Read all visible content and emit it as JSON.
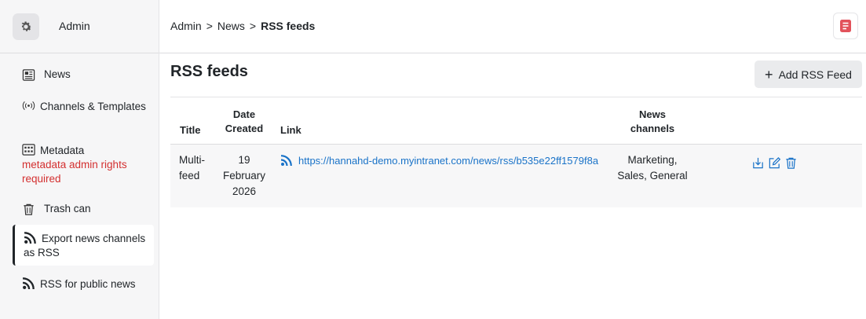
{
  "sidebar": {
    "title": "Admin",
    "items": [
      {
        "label": "News",
        "icon": "newspaper-icon"
      },
      {
        "label": "Channels & Templates",
        "icon": "broadcast-icon"
      },
      {
        "label": "Metadata",
        "warning": "metadata admin rights required",
        "icon": "metadata-icon"
      },
      {
        "label": "Trash can",
        "icon": "trash-icon"
      },
      {
        "label": "Export news channels as RSS",
        "icon": "rss-icon",
        "active": true
      },
      {
        "label": "RSS for public news",
        "icon": "rss-icon"
      }
    ]
  },
  "breadcrumb": {
    "items": [
      "Admin",
      "News"
    ],
    "current": "RSS feeds",
    "separator": ">"
  },
  "main": {
    "title": "RSS feeds",
    "add_button": "Add RSS Feed",
    "add_button_icon": "plus-icon"
  },
  "table": {
    "headers": {
      "title": "Title",
      "date_created": "Date Created",
      "link": "Link",
      "news_channels": "News channels"
    },
    "rows": [
      {
        "title": "Multi-feed",
        "date_created": "19 February 2026",
        "link": "https://hannahd-demo.myintranet.com/news/rss/b535e22ff1579f8a",
        "news_channels": "Marketing, Sales, General",
        "actions": [
          "download-icon",
          "edit-icon",
          "trash-icon"
        ]
      }
    ]
  },
  "colors": {
    "link": "#1a73c8",
    "warning": "#d32f2f",
    "accent_icon": "#e2525b",
    "sidebar_bg": "#f6f6f7",
    "row_bg": "#f7f7f8"
  }
}
